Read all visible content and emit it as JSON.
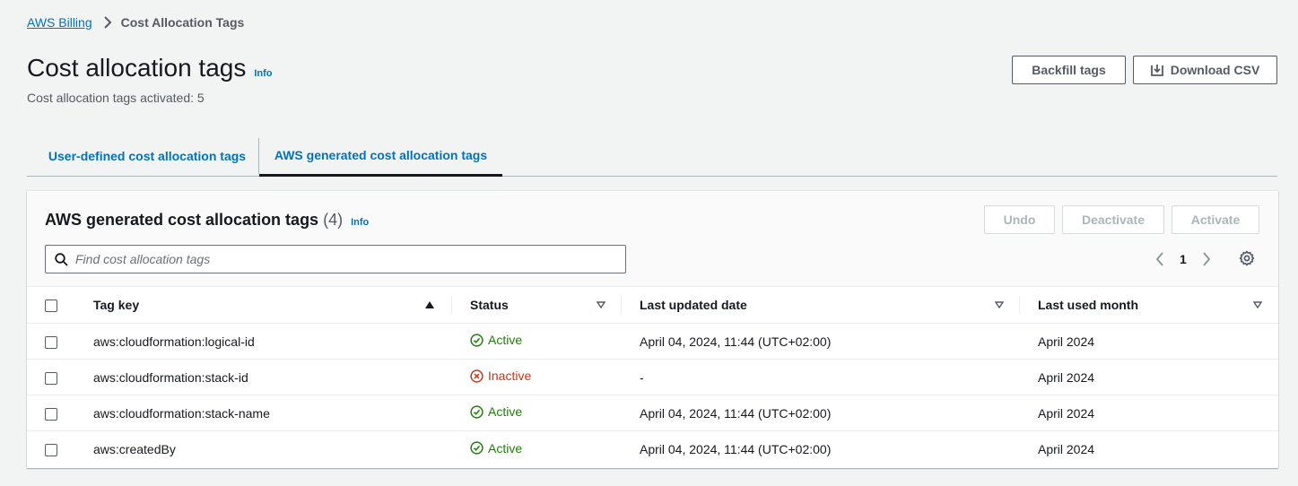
{
  "breadcrumb": {
    "parent": "AWS Billing",
    "current": "Cost Allocation Tags"
  },
  "page": {
    "title": "Cost allocation tags",
    "info_label": "Info",
    "subtitle": "Cost allocation tags activated: 5"
  },
  "header_actions": {
    "backfill_label": "Backfill tags",
    "download_label": "Download CSV"
  },
  "tabs": [
    {
      "label": "User-defined cost allocation tags",
      "active": false
    },
    {
      "label": "AWS generated cost allocation tags",
      "active": true
    }
  ],
  "panel": {
    "title": "AWS generated cost allocation tags",
    "count": "(4)",
    "info_label": "Info",
    "undo_label": "Undo",
    "deactivate_label": "Deactivate",
    "activate_label": "Activate",
    "search_placeholder": "Find cost allocation tags",
    "page_number": "1"
  },
  "table": {
    "columns": [
      "Tag key",
      "Status",
      "Last updated date",
      "Last used month"
    ],
    "rows": [
      {
        "tag_key": "aws:cloudformation:logical-id",
        "status": "Active",
        "last_updated": "April 04, 2024, 11:44 (UTC+02:00)",
        "last_used": "April 2024"
      },
      {
        "tag_key": "aws:cloudformation:stack-id",
        "status": "Inactive",
        "last_updated": "-",
        "last_used": "April 2024"
      },
      {
        "tag_key": "aws:cloudformation:stack-name",
        "status": "Active",
        "last_updated": "April 04, 2024, 11:44 (UTC+02:00)",
        "last_used": "April 2024"
      },
      {
        "tag_key": "aws:createdBy",
        "status": "Active",
        "last_updated": "April 04, 2024, 11:44 (UTC+02:00)",
        "last_used": "April 2024"
      }
    ]
  },
  "colors": {
    "link": "#0073bb",
    "active": "#1d8102",
    "inactive": "#d13212",
    "background": "#f2f3f3"
  }
}
